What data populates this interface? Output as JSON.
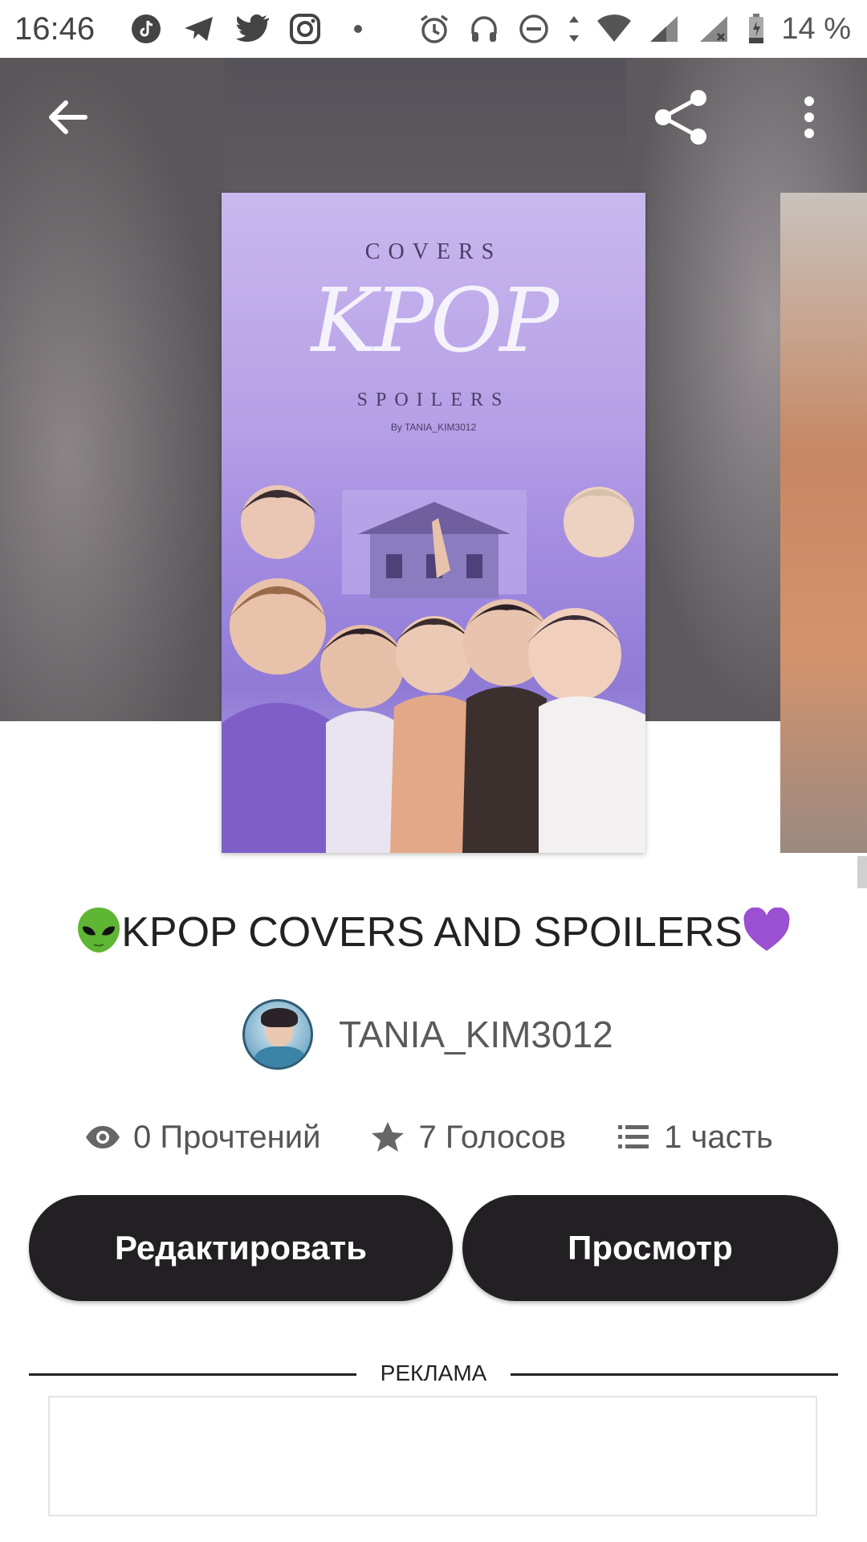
{
  "status_bar": {
    "time": "16:46",
    "battery": "14 %",
    "left_icons": [
      "tiktok-icon",
      "telegram-icon",
      "twitter-icon",
      "instagram-icon",
      "dot-icon"
    ],
    "right_icons": [
      "alarm-icon",
      "headphones-icon",
      "dnd-icon",
      "data-arrows-icon",
      "wifi-icon",
      "signal-icon",
      "signal-x-icon",
      "battery-icon"
    ]
  },
  "toolbar": {
    "back_icon": "arrow-left-icon",
    "share_icon": "share-icon",
    "more_icon": "more-vertical-icon"
  },
  "cover": {
    "top_text": "COVERS",
    "main_text": "KPOP",
    "bottom_text": "SPOILERS",
    "byline": "By TANIA_KIM3012"
  },
  "story": {
    "title_emoji_left": "👽",
    "title": "KPOP COVERS AND SPOILERS",
    "title_emoji_right": "💜",
    "author": "TANIA_KIM3012"
  },
  "stats": {
    "reads": "0 Прочтений",
    "votes": "7 Голосов",
    "parts": "1 часть"
  },
  "buttons": {
    "edit": "Редактировать",
    "view": "Просмотр"
  },
  "ad": {
    "label": "РЕКЛАМА"
  },
  "colors": {
    "button_bg": "#222022",
    "cover_purple": "#b6a0e6",
    "hero_bg": "#5f5b5f"
  }
}
